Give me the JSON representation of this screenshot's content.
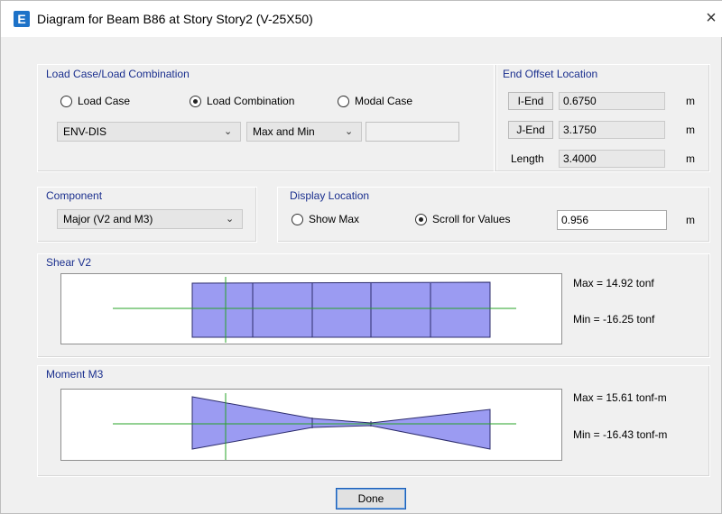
{
  "window": {
    "icon_letter": "E",
    "title": "Diagram for Beam B86 at Story Story2 (V-25X50)",
    "close_glyph": "×"
  },
  "load_case_group": {
    "title": "Load Case/Load Combination",
    "radios": [
      {
        "label": "Load Case",
        "selected": false
      },
      {
        "label": "Load Combination",
        "selected": true
      },
      {
        "label": "Modal Case",
        "selected": false
      }
    ],
    "combo_value": "ENV-DIS",
    "envelope_value": "Max and Min",
    "extra_value": ""
  },
  "end_offset": {
    "title": "End Offset Location",
    "i_end_label": "I-End",
    "i_end_value": "0.6750",
    "j_end_label": "J-End",
    "j_end_value": "3.1750",
    "length_label": "Length",
    "length_value": "3.4000",
    "unit": "m"
  },
  "component": {
    "title": "Component",
    "value": "Major (V2 and M3)"
  },
  "display_location": {
    "title": "Display Location",
    "show_max_label": "Show Max",
    "scroll_label": "Scroll for Values",
    "show_max_selected": false,
    "scroll_selected": true,
    "scroll_value": "0.956",
    "unit": "m"
  },
  "shear": {
    "title": "Shear V2",
    "max_text": "Max = 14.92 tonf",
    "min_text": "Min = -16.25 tonf",
    "fill_color": "#9b9bf2",
    "axis_color": "#27a327"
  },
  "moment": {
    "title": "Moment M3",
    "max_text": "Max = 15.61 tonf-m",
    "min_text": "Min = -16.43 tonf-m",
    "fill_color": "#9b9bf2",
    "axis_color": "#27a327"
  },
  "done_label": "Done"
}
